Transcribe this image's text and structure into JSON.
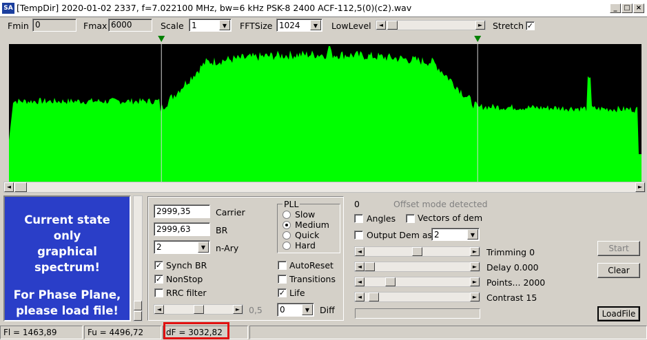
{
  "window": {
    "icon_text": "SA",
    "title": "[TempDir] 2020-01-02 2337, f=7.022100 MHz, bw=6 kHz PSK-8 2400 ACF-112,5(0)(c2).wav",
    "minimize": "_",
    "maximize": "□",
    "close": "×"
  },
  "toolbar": {
    "fmin_label": "Fmin",
    "fmin_value": "0",
    "fmax_label": "Fmax",
    "fmax_value": "6000",
    "scale_label": "Scale",
    "scale_value": "1",
    "fftsize_label": "FFTSize",
    "fftsize_value": "1024",
    "lowlevel_label": "LowLevel",
    "stretch_label": "Stretch",
    "stretch_checked": "✓",
    "lowlevel_position": 0.02
  },
  "spectrum": {
    "background": "#000000",
    "fill_color": "#00ff00",
    "marker_color": "#008000",
    "marker_1_fraction": 0.241,
    "marker_2_fraction": 0.741
  },
  "info_panel": {
    "line1": "Current state",
    "line2": "only",
    "line3": "graphical spectrum!",
    "line4": "For Phase Plane,",
    "line5": "please load file!",
    "bg_color": "#2a3ec8"
  },
  "demod": {
    "carrier_value": "2999,35",
    "carrier_label": "Carrier",
    "br_value": "2999,63",
    "br_label": "BR",
    "nary_value": "2",
    "nary_label": "n-Ary",
    "synch_br_label": "Synch BR",
    "synch_br_checked": "✓",
    "nonstop_label": "NonStop",
    "nonstop_checked": "✓",
    "rrc_label": "RRC filter",
    "rrc_checked": "",
    "rolloff_value": "0,5",
    "rolloff_position": 0.5,
    "pll_title": "PLL",
    "pll_options": [
      "Slow",
      "Medium",
      "Quick",
      "Hard"
    ],
    "pll_selected": "Medium",
    "autoreset_label": "AutoReset",
    "autoreset_checked": "",
    "transitions_label": "Transitions",
    "transitions_checked": "",
    "life_label": "Life",
    "life_checked": "✓",
    "diff_value": "0",
    "diff_label": "Diff"
  },
  "right": {
    "offset_value": "0",
    "offset_status": "Offset mode detected",
    "angles_label": "Angles",
    "angles_checked": "",
    "vectors_label": "Vectors of dem",
    "vectors_checked": "",
    "output_label": "Output Dem as",
    "output_checked": "",
    "output_value": "2",
    "trimming_label": "Trimming 0",
    "trimming_position": 0.5,
    "delay_label": "Delay  0.000",
    "delay_position": 0.0,
    "points_label": "Points... 2000",
    "points_position": 0.22,
    "contrast_label": "Contrast 15",
    "contrast_position": 0.04,
    "start_label": "Start",
    "clear_label": "Clear",
    "loadfile_label": "LoadFile"
  },
  "status": {
    "fl": "Fl = 1463,89",
    "fu": "Fu = 4496,72",
    "df": "dF = 3032,82",
    "highlight_color": "#e01010"
  }
}
